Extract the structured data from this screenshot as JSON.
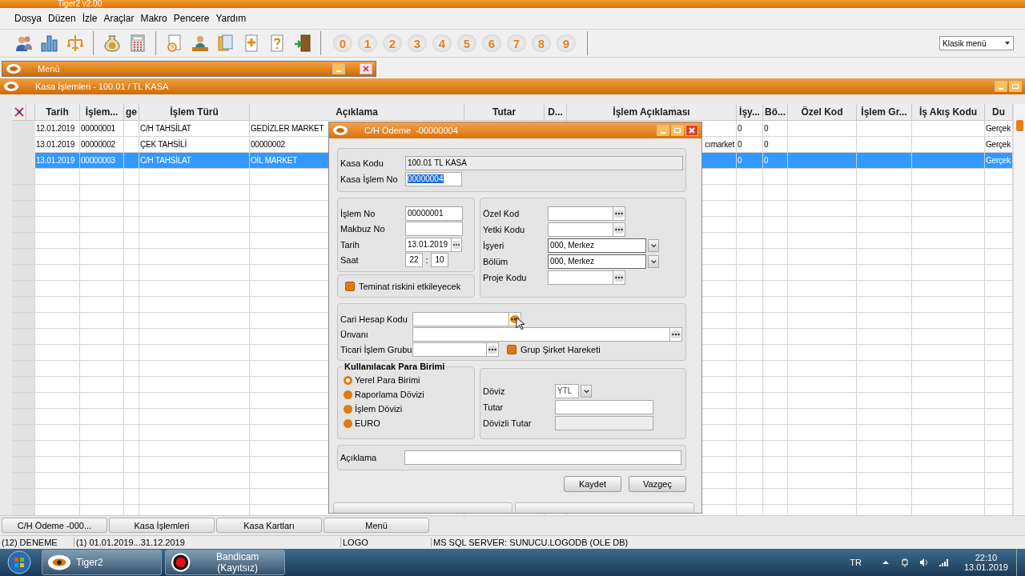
{
  "app": {
    "title": "Tiger2 v2.00"
  },
  "menu": [
    "Dosya",
    "Düzen",
    "İzle",
    "Araçlar",
    "Makro",
    "Pencere",
    "Yardım"
  ],
  "toolbar": {
    "number_buttons": [
      "0",
      "1",
      "2",
      "3",
      "4",
      "5",
      "6",
      "7",
      "8",
      "9"
    ],
    "menu_style": "Klasik menü"
  },
  "menu_window": {
    "title": "Menü"
  },
  "kasa_window": {
    "title": "Kasa İşlemleri - 100.01 / TL KASA",
    "columns": [
      "Tarih",
      "İşlem...",
      "ge",
      "İşlem Türü",
      "Açıklama",
      "Tutar",
      "D...",
      "İşlem Açıklaması",
      "İşy...",
      "Bö...",
      "Özel Kod",
      "İşlem Gr...",
      "İş Akış Kodu",
      "Du"
    ],
    "rows": [
      {
        "tarih": "12.01.2019",
        "islem_no": "00000001",
        "islem_turu": "C/H TAHSİLAT",
        "aciklama": "GEDİZLER MARKET",
        "isyeri": "0",
        "bolum": "0",
        "durum": "Gerçek",
        "selected": false
      },
      {
        "tarih": "13.01.2019",
        "islem_no": "00000002",
        "islem_turu": "ÇEK TAHSİLİ",
        "aciklama": "00000002",
        "islem_aciklamasi": "cımarket",
        "isyeri": "0",
        "bolum": "0",
        "durum": "Gerçek",
        "selected": false
      },
      {
        "tarih": "13.01.2019",
        "islem_no": "00000003",
        "islem_turu": "C/H TAHSİLAT",
        "aciklama": "OİL MARKET",
        "isyeri": "0",
        "bolum": "0",
        "durum": "Gerçek",
        "selected": true
      }
    ]
  },
  "dialog": {
    "title": "C/H Ödeme  -00000004",
    "header_fields": [
      {
        "label": "Kasa Kodu",
        "kind": "readonly",
        "value": "100.01 TL KASA"
      },
      {
        "label": "Kasa İşlem No",
        "kind": "text",
        "value": "00000004",
        "focused": true
      }
    ],
    "left_fields": [
      {
        "label": "İşlem No",
        "kind": "text",
        "value": "00000001"
      },
      {
        "label": "Makbuz No",
        "kind": "text"
      },
      {
        "label": "Tarih",
        "kind": "lookup",
        "value": "13.01.2019"
      },
      {
        "label": "Saat",
        "kind": "time",
        "hour": "22",
        "separator": ":",
        "minute": "10"
      }
    ],
    "teminat": {
      "label": "Teminat riskini etkileyecek",
      "checked": false
    },
    "right_fields": [
      {
        "label": "Özel Kod",
        "kind": "lookup"
      },
      {
        "label": "Yetki Kodu",
        "kind": "lookup"
      },
      {
        "label": "İşyeri",
        "kind": "combo",
        "value": "000, Merkez"
      },
      {
        "label": "Bölüm",
        "kind": "combo",
        "value": "000, Merkez"
      },
      {
        "label": "Proje Kodu",
        "kind": "lookup"
      }
    ],
    "cari_fields": [
      {
        "label": "Cari Hesap Kodu",
        "kind": "lookup",
        "hovered": true
      },
      {
        "label": "Ünvanı",
        "kind": "lookup",
        "hovered": false
      },
      {
        "label": "Ticari İşlem Grubu",
        "kind": "lookup",
        "hovered": false
      }
    ],
    "grup_sirket": {
      "label": "Grup Şirket Hareketi",
      "checked": false
    },
    "currency": {
      "title": "Kullanılacak Para Birimi",
      "options": [
        {
          "label": "Yerel Para Birimi",
          "selected": true
        },
        {
          "label": "Raporlama Dövizi",
          "selected": false
        },
        {
          "label": "İşlem Dövizi",
          "selected": false
        },
        {
          "label": "EURO",
          "selected": false
        }
      ]
    },
    "amount_fields": [
      {
        "label": "Döviz",
        "kind": "combo",
        "value": "YTL"
      },
      {
        "label": "Tutar",
        "kind": "text"
      },
      {
        "label": "Dövizli Tutar",
        "kind": "readonly"
      }
    ],
    "description": {
      "label": "Açıklama"
    },
    "buttons": [
      "Kaydet",
      "Vazgeç"
    ]
  },
  "task_buttons": [
    "C/H Ödeme  -000...",
    "Kasa İşlemleri",
    "Kasa Kartları",
    "Menü"
  ],
  "status_bar": [
    "(12) DENEME",
    "(1) 01.01.2019...31.12.2019",
    "LOGO",
    "MS SQL SERVER: SUNUCU.LOGODB (OLE DB)"
  ],
  "taskbar": {
    "apps": [
      {
        "label": "Tiger2",
        "kind": "tiger"
      },
      {
        "label": "Bandicam (Kayıtsız)",
        "kind": "record"
      }
    ],
    "language": "TR",
    "time": "22:10",
    "date": "13.01.2019"
  }
}
